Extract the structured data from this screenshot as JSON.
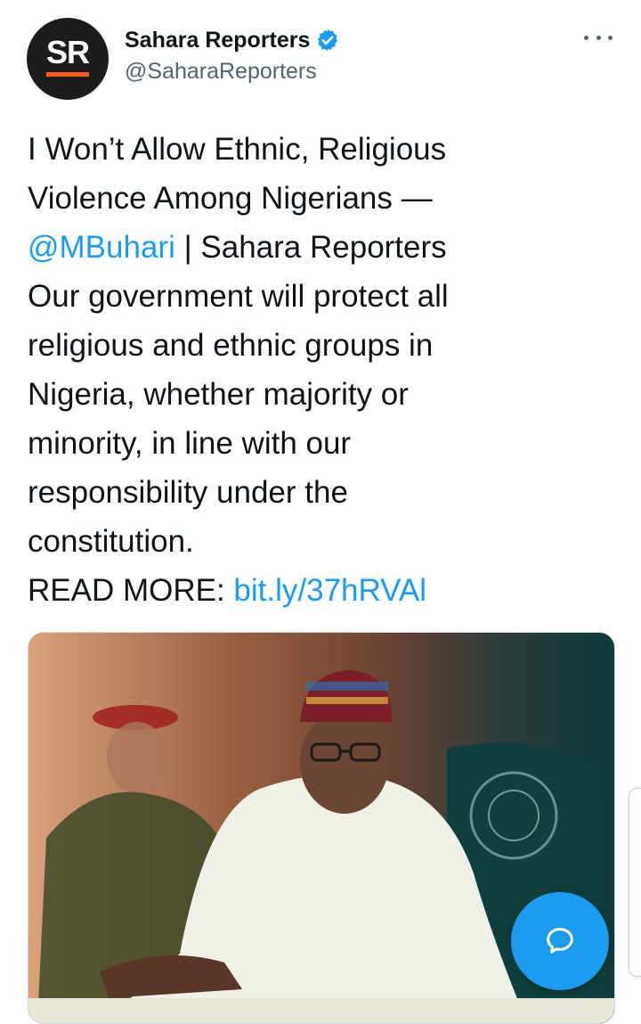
{
  "author": {
    "avatar_text": "SR",
    "display_name": "Sahara Reporters",
    "handle": "@SaharaReporters",
    "verified": true
  },
  "tweet": {
    "line1": "I Won’t Allow Ethnic, Religious",
    "line2": "Violence Among Nigerians —",
    "mention": "@MBuhari",
    "line3_rest": " | Sahara Reporters",
    "line4": "Our government will protect all",
    "line5": "religious and ethnic groups in",
    "line6": "Nigeria, whether majority or",
    "line7": "minority, in line with our",
    "line8": "responsibility under the",
    "line9": "constitution.",
    "read_more_label": "READ MORE: ",
    "link": "bit.ly/37hRVAl"
  },
  "media": {
    "icon": "photo"
  },
  "actions": {
    "more_icon": "more-horizontal-icon",
    "reply_icon": "reply-bubble-icon"
  },
  "colors": {
    "link": "#1d9bf0",
    "fab": "#1d9bf0",
    "avatar_bg": "#1c1c1c",
    "avatar_accent": "#ff5a1f"
  }
}
